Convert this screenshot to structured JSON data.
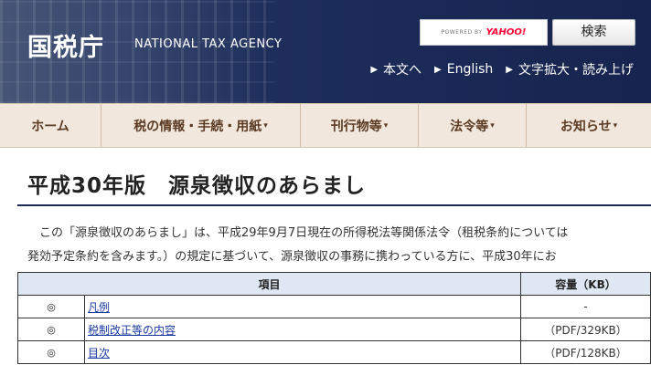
{
  "header": {
    "logo_text": "国税庁",
    "agency_en": "NATIONAL TAX AGENCY",
    "search": {
      "powered_by": "POWERED BY",
      "provider": "YAHOO!",
      "button_label": "検索"
    },
    "util_links": [
      "本文へ",
      "English",
      "文字拡大・読み上げ"
    ]
  },
  "nav": {
    "items": [
      {
        "label": "ホーム",
        "caret": ""
      },
      {
        "label": "税の情報・手続・用紙",
        "caret": "▾"
      },
      {
        "label": "刊行物等",
        "caret": "▾"
      },
      {
        "label": "法令等",
        "caret": "▾"
      },
      {
        "label": "お知らせ",
        "caret": "▾"
      }
    ]
  },
  "page": {
    "title": "平成30年版　源泉徴収のあらまし",
    "intro_line1": "　この「源泉徴収のあらまし」は、平成29年9月7日現在の所得税法等関係法令（租税条約については",
    "intro_line2": "発効予定条約を含みます。）の規定に基づいて、源泉徴収の事務に携わっている方に、平成30年にお"
  },
  "table": {
    "headers": [
      "項目",
      "容量（KB）"
    ],
    "rows": [
      {
        "mark": "◎",
        "item": "凡例",
        "size": "-"
      },
      {
        "mark": "◎",
        "item": "税制改正等の内容",
        "size": "（PDF/329KB）"
      },
      {
        "mark": "◎",
        "item": "目次",
        "size": "（PDF/128KB）"
      }
    ]
  },
  "colors": {
    "header_bg": "#1b2a57",
    "nav_bg": "#f2e7dc",
    "nav_text": "#5a3a22",
    "table_header_bg": "#dfe7f3",
    "link": "#1a3aa0"
  }
}
